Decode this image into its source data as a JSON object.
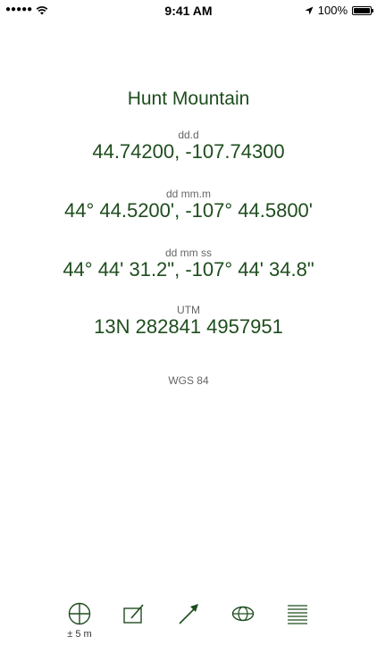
{
  "status_bar": {
    "signal_dots": "●●●●●",
    "time": "9:41 AM",
    "battery_percent": "100%"
  },
  "location": {
    "name": "Hunt Mountain"
  },
  "formats": [
    {
      "label": "dd.d",
      "value": "44.74200, -107.74300"
    },
    {
      "label": "dd mm.m",
      "value": "44° 44.5200', -107° 44.5800'"
    },
    {
      "label": "dd mm ss",
      "value": "44° 44' 31.2\", -107° 44' 34.8\""
    },
    {
      "label": "UTM",
      "value": "13N 282841 4957951"
    }
  ],
  "datum": "WGS 84",
  "toolbar": {
    "accuracy_label": "± 5 m",
    "icons": [
      "crosshair-icon",
      "edit-icon",
      "direction-arrow-icon",
      "globe-icon",
      "list-icon"
    ]
  },
  "colors": {
    "accent": "#1e4d1e"
  }
}
